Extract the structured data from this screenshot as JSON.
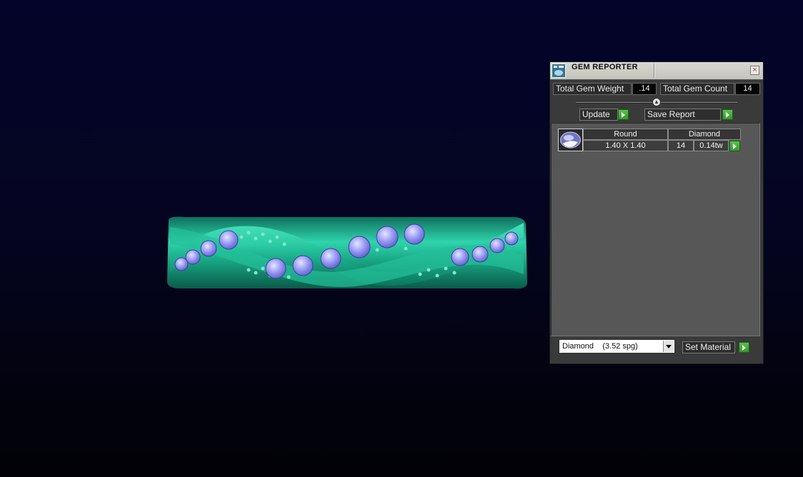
{
  "panel": {
    "title": "GEM REPORTER",
    "close_glyph": "×",
    "total_gem_weight_label": "Total Gem Weight",
    "total_gem_weight_value": ".14",
    "total_gem_count_label": "Total Gem Count",
    "total_gem_count_value": "14",
    "slider_position": 0.5,
    "update_label": "Update",
    "save_report_label": "Save Report",
    "report": {
      "headers": [
        "Round",
        "Diamond"
      ],
      "row": {
        "size": "1.40 X 1.40",
        "count": "14",
        "weight": "0.14tw"
      }
    },
    "material_selected": "Diamond    (3.52 spg)",
    "set_material_label": "Set Material"
  },
  "icons": {
    "app": "gem-reporter-app-icon",
    "close": "close-icon",
    "arrow": "play-arrow-icon",
    "thumbnail": "gem-thumbnail-icon",
    "dropdown": "chevron-down-icon",
    "slider": "slider-knob-icon"
  },
  "colors": {
    "ring_metal": "#1aa98a",
    "gem_blue": "#8a8cf0",
    "accent_green": "#3fae31",
    "panel_bg": "#3a3a3a"
  }
}
